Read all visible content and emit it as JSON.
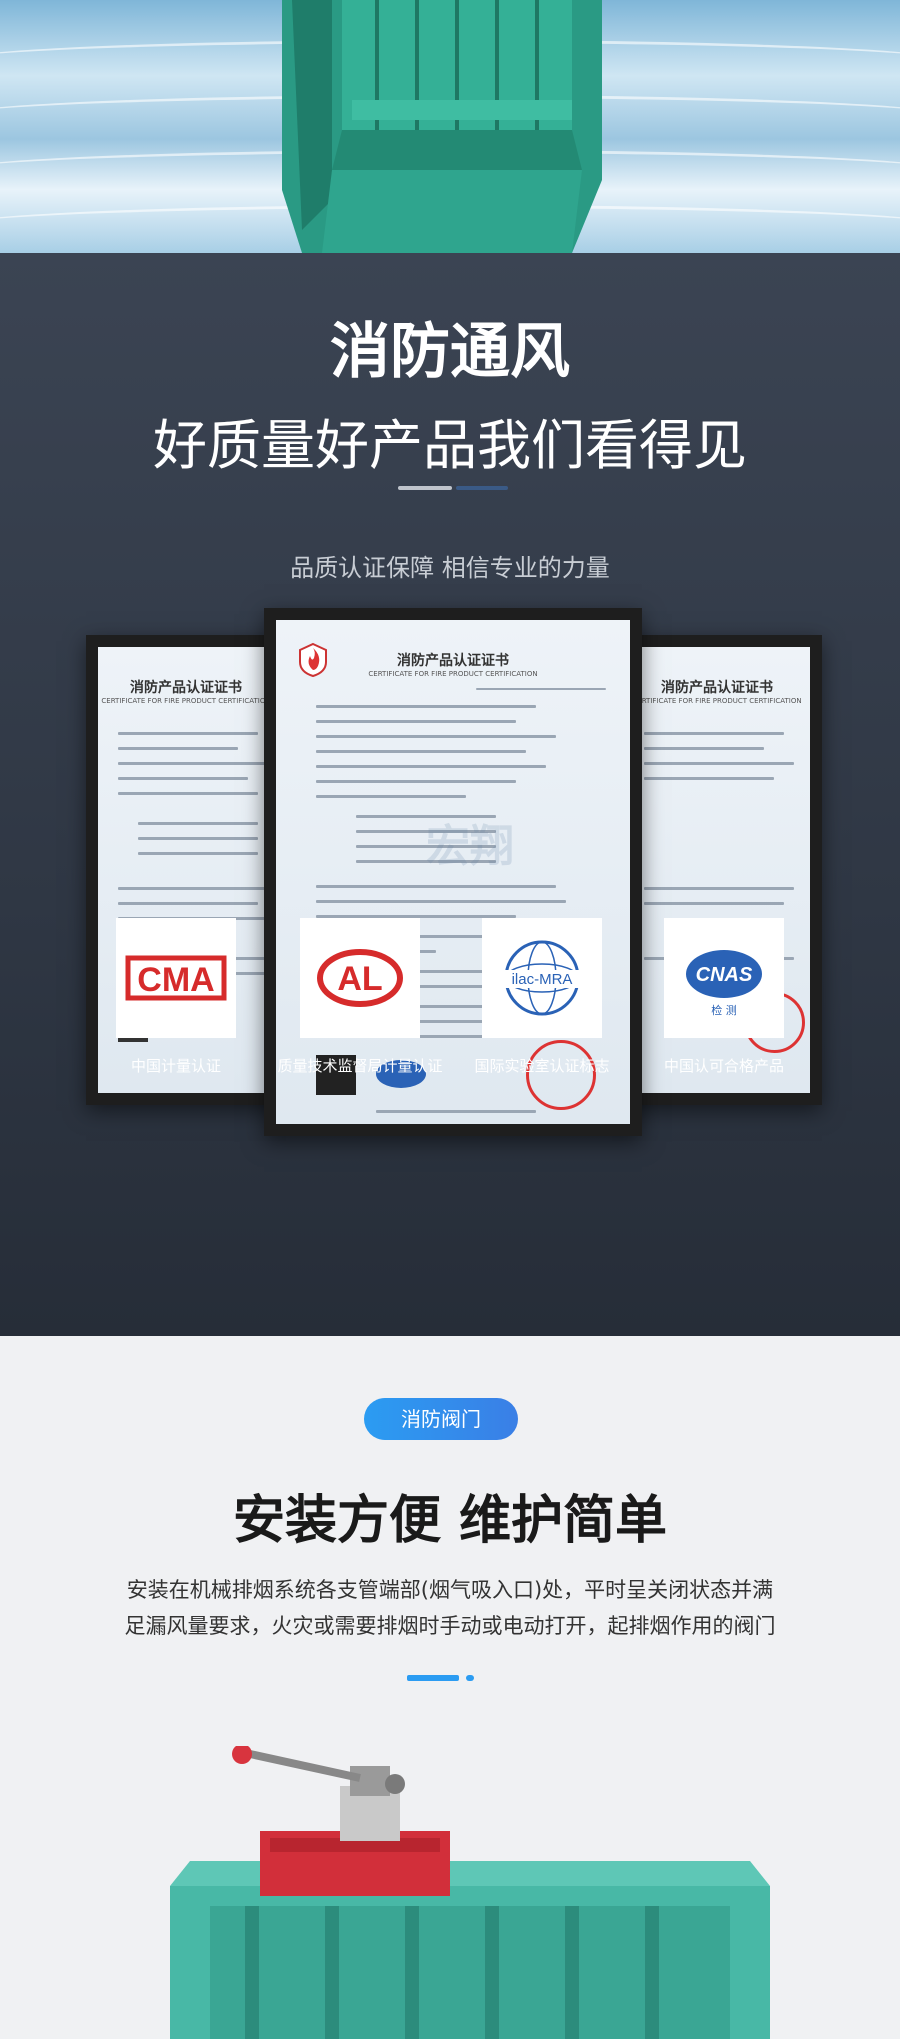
{
  "headline": "消防通风",
  "subheadline": "好质量好产品我们看得见",
  "tagline": "品质认证保障 相信专业的力量",
  "certificate": {
    "title": "消防产品认证证书",
    "subtitle": "CERTIFICATE FOR FIRE PRODUCT CERTIFICATION",
    "watermark": "宏翔"
  },
  "badges": [
    {
      "logo": "CMA",
      "label": "中国计量认证",
      "color": "#d62b2b"
    },
    {
      "logo": "CAL",
      "label": "质量技术监督局计量认证",
      "color": "#d62b2b"
    },
    {
      "logo": "ilac-MRA",
      "label": "国际实验室认证标志",
      "color": "#2a62b6"
    },
    {
      "logo": "CNAS",
      "label": "中国认可合格产品",
      "color": "#2a62b6"
    }
  ],
  "install": {
    "pill": "消防阀门",
    "title": "安装方便  维护简单",
    "desc_line1": "安装在机械排烟系统各支管端部(烟气吸入口)处，平时呈关闭状态并满",
    "desc_line2": "足漏风量要求，火灾或需要排烟时手动或电动打开，起排烟作用的阀门"
  },
  "colors": {
    "accent_blue": "#2b9cf2",
    "damper_green": "#2fa58e",
    "dark_bg": "#2f3744"
  }
}
